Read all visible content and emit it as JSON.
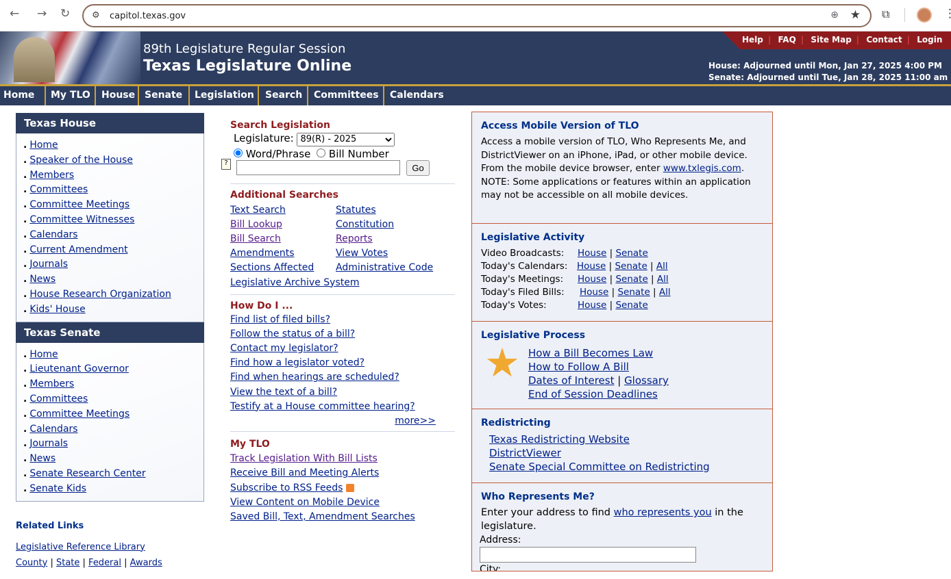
{
  "browser": {
    "url": "capitol.texas.gov"
  },
  "header": {
    "session": "89th Legislature Regular Session",
    "site_title": "Texas Legislature Online",
    "top_links": [
      "Help",
      "FAQ",
      "Site Map",
      "Contact",
      "Login"
    ],
    "house_status": "House: Adjourned until Mon, Jan 27, 2025 4:00 PM",
    "senate_status": "Senate: Adjourned until Tue, Jan 28, 2025 11:00 am"
  },
  "menu": [
    "Home",
    "My TLO",
    "House",
    "Senate",
    "Legislation",
    "Search",
    "Committees",
    "Calendars"
  ],
  "house": {
    "title": "Texas House",
    "links": [
      "Home",
      "Speaker of the House",
      "Members",
      "Committees",
      "Committee Meetings",
      "Committee Witnesses",
      "Calendars",
      "Current Amendment",
      "Journals",
      "News",
      "House Research Organization",
      "Kids' House"
    ]
  },
  "senate": {
    "title": "Texas Senate",
    "links": [
      "Home",
      "Lieutenant Governor",
      "Members",
      "Committees",
      "Committee Meetings",
      "Calendars",
      "Journals",
      "News",
      "Senate Research Center",
      "Senate Kids"
    ]
  },
  "related": {
    "title": "Related Links",
    "library": "Legislative Reference Library",
    "gov_links": [
      "County",
      "State",
      "Federal",
      "Awards"
    ]
  },
  "search": {
    "title": "Search Legislation",
    "legislature_label": "Legislature:",
    "legislature_value": "89(R) - 2025",
    "opt_word": "Word/Phrase",
    "opt_bill": "Bill Number",
    "go": "Go"
  },
  "additional": {
    "title": "Additional Searches",
    "left": [
      "Text Search",
      "Bill Lookup",
      "Bill Search",
      "Amendments",
      "Sections Affected"
    ],
    "right": [
      "Statutes",
      "Constitution",
      "Reports",
      "View Votes",
      "Administrative Code"
    ],
    "archive": "Legislative Archive System"
  },
  "howdoi": {
    "title": "How Do I ...",
    "links": [
      "Find list of filed bills?",
      "Follow the status of a bill?",
      "Contact my legislator?",
      "Find how a legislator voted?",
      "Find when hearings are scheduled?",
      "View the text of a bill?",
      "Testify at a House committee hearing?"
    ],
    "more": "more>>"
  },
  "mytlo": {
    "title": "My TLO",
    "links": [
      "Track Legislation With Bill Lists",
      "Receive Bill and Meeting Alerts",
      "Subscribe to RSS Feeds",
      "View Content on Mobile Device",
      "Saved Bill, Text, Amendment Searches"
    ]
  },
  "mobile": {
    "title": "Access Mobile Version of TLO",
    "text1": "Access a mobile version of TLO, Who Represents Me, and DistrictViewer on an iPhone, iPad, or other mobile device. From the mobile device browser, enter",
    "link": "www.txlegis.com",
    "text2": ". NOTE: Some applications or features within an application may not be accessible on all mobile devices."
  },
  "activity": {
    "title": "Legislative Activity",
    "rows": [
      {
        "label": "Video Broadcasts:",
        "links": [
          "House",
          "Senate"
        ]
      },
      {
        "label": "Today's Calendars:",
        "links": [
          "House",
          "Senate",
          "All"
        ]
      },
      {
        "label": "Today's Meetings:",
        "links": [
          "House",
          "Senate",
          "All"
        ]
      },
      {
        "label": "Today's Filed Bills:",
        "links": [
          "House",
          "Senate",
          "All"
        ]
      },
      {
        "label": "Today's Votes:",
        "links": [
          "House",
          "Senate"
        ]
      }
    ]
  },
  "process": {
    "title": "Legislative Process",
    "links": [
      "How a Bill Becomes Law",
      "How to Follow A Bill",
      "Dates of Interest",
      "Glossary",
      "End of Session Deadlines"
    ]
  },
  "redistricting": {
    "title": "Redistricting",
    "links": [
      "Texas Redistricting Website",
      "DistrictViewer",
      "Senate Special Committee on Redistricting"
    ]
  },
  "represents": {
    "title": "Who Represents Me?",
    "text1": "Enter your address to find",
    "link": "who represents you",
    "text2": "in the legislature.",
    "address_label": "Address:",
    "city_label": "City:"
  }
}
